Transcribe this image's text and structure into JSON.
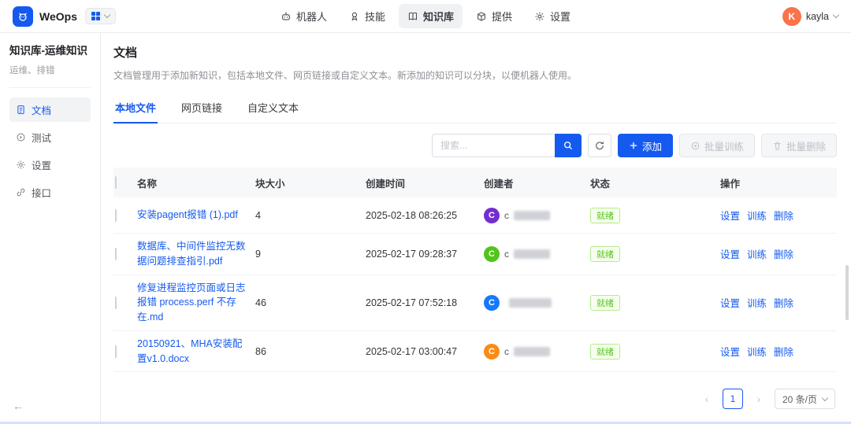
{
  "colors": {
    "primary": "#155aef",
    "success_text": "#52c41a",
    "success_bg": "#f6ffed",
    "success_border": "#b7eb8f"
  },
  "topbar": {
    "app_name": "WeOps",
    "nav": [
      {
        "label": "机器人"
      },
      {
        "label": "技能"
      },
      {
        "label": "知识库",
        "active": true
      },
      {
        "label": "提供"
      },
      {
        "label": "设置"
      }
    ],
    "user": {
      "initial": "K",
      "name": "kayla"
    }
  },
  "sidebar": {
    "title": "知识库-运维知识",
    "subtitle": "运维、排错",
    "items": [
      {
        "label": "文档",
        "active": true
      },
      {
        "label": "测试"
      },
      {
        "label": "设置"
      },
      {
        "label": "接口"
      }
    ],
    "collapse_arrow": "←"
  },
  "main": {
    "title": "文档",
    "description": "文档管理用于添加新知识，包括本地文件、网页链接或自定义文本。新添加的知识可以分块，以便机器人使用。",
    "tabs": [
      {
        "label": "本地文件",
        "active": true
      },
      {
        "label": "网页链接"
      },
      {
        "label": "自定义文本"
      }
    ],
    "toolbar": {
      "search_placeholder": "搜索...",
      "add_label": "添加",
      "batch_train_label": "批量训练",
      "batch_delete_label": "批量删除"
    },
    "table": {
      "columns": [
        "名称",
        "块大小",
        "创建时间",
        "创建者",
        "状态",
        "操作"
      ],
      "action_labels": [
        "设置",
        "训练",
        "删除"
      ],
      "rows": [
        {
          "name": "安装pagent报错 (1).pdf",
          "size": "4",
          "created": "2025-02-18 08:26:25",
          "creator_initial": "C",
          "creator_prefix": "c",
          "creator_color": "#722ed1",
          "status": "就绪"
        },
        {
          "name": "数据库、中间件监控无数据问题排查指引.pdf",
          "size": "9",
          "created": "2025-02-17 09:28:37",
          "creator_initial": "C",
          "creator_prefix": "c",
          "creator_color": "#52c41a",
          "status": "就绪"
        },
        {
          "name": "修复进程监控页面或日志报错 process.perf 不存在.md",
          "size": "46",
          "created": "2025-02-17 07:52:18",
          "creator_initial": "C",
          "creator_prefix": "",
          "creator_color": "#1677ff",
          "status": "就绪"
        },
        {
          "name": "20150921、MHA安装配置v1.0.docx",
          "size": "86",
          "created": "2025-02-17 03:00:47",
          "creator_initial": "C",
          "creator_prefix": "c",
          "creator_color": "#fa8c16",
          "status": "就绪"
        }
      ]
    },
    "pagination": {
      "prev": "‹",
      "page": "1",
      "next": "›",
      "page_size_label": "20 条/页"
    }
  }
}
